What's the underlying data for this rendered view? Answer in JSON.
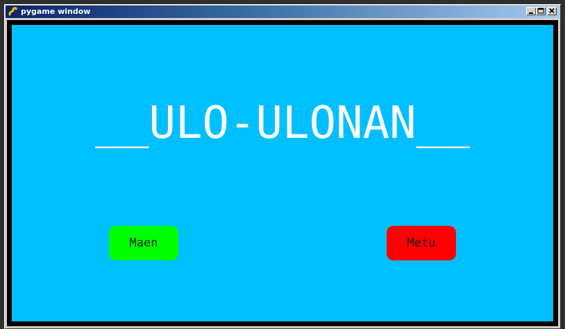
{
  "window": {
    "title": "pygame window",
    "app_icon": "pygame-snake-icon",
    "controls": {
      "minimize_icon": "minimize-icon",
      "maximize_icon": "maximize-icon",
      "close_icon": "close-icon"
    }
  },
  "game": {
    "background_color": "#00bfff",
    "title_text": "__ULO-ULONAN__",
    "buttons": [
      {
        "label": "Maen",
        "color": "#00ff00"
      },
      {
        "label": "Metu",
        "color": "#ff0000"
      }
    ]
  }
}
